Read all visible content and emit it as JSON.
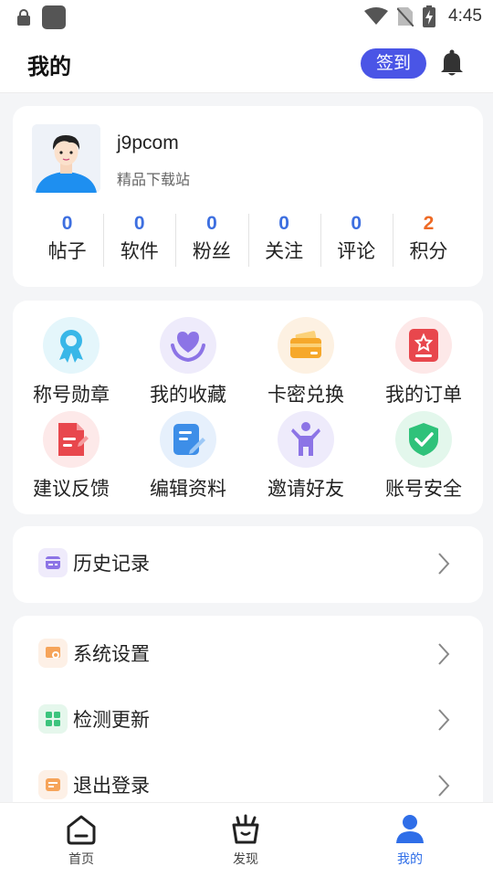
{
  "status_bar": {
    "time": "4:45"
  },
  "header": {
    "title": "我的",
    "checkin_label": "签到"
  },
  "profile": {
    "username": "j9pcom",
    "subtitle": "精品下载站",
    "stats": [
      {
        "value": "0",
        "label": "帖子"
      },
      {
        "value": "0",
        "label": "软件"
      },
      {
        "value": "0",
        "label": "粉丝"
      },
      {
        "value": "0",
        "label": "关注"
      },
      {
        "value": "0",
        "label": "评论"
      },
      {
        "value": "2",
        "label": "积分"
      }
    ]
  },
  "grid": [
    {
      "label": "称号勋章",
      "icon": "medal-icon"
    },
    {
      "label": "我的收藏",
      "icon": "heart-hands-icon"
    },
    {
      "label": "卡密兑换",
      "icon": "card-icon"
    },
    {
      "label": "我的订单",
      "icon": "order-icon"
    },
    {
      "label": "建议反馈",
      "icon": "feedback-icon"
    },
    {
      "label": "编辑资料",
      "icon": "edit-icon"
    },
    {
      "label": "邀请好友",
      "icon": "invite-icon"
    },
    {
      "label": "账号安全",
      "icon": "shield-icon"
    }
  ],
  "history": {
    "label": "历史记录"
  },
  "settings": [
    {
      "label": "系统设置",
      "icon": "settings-icon"
    },
    {
      "label": "检测更新",
      "icon": "update-icon"
    },
    {
      "label": "退出登录",
      "icon": "logout-icon"
    }
  ],
  "tabs": [
    {
      "label": "首页",
      "icon": "home-icon"
    },
    {
      "label": "发现",
      "icon": "discover-icon"
    },
    {
      "label": "我的",
      "icon": "profile-icon"
    }
  ],
  "colors": {
    "accent": "#4a55e6",
    "stat_blue": "#3d6fe0",
    "stat_orange": "#ee6a25",
    "tab_active": "#2f6ee8"
  }
}
